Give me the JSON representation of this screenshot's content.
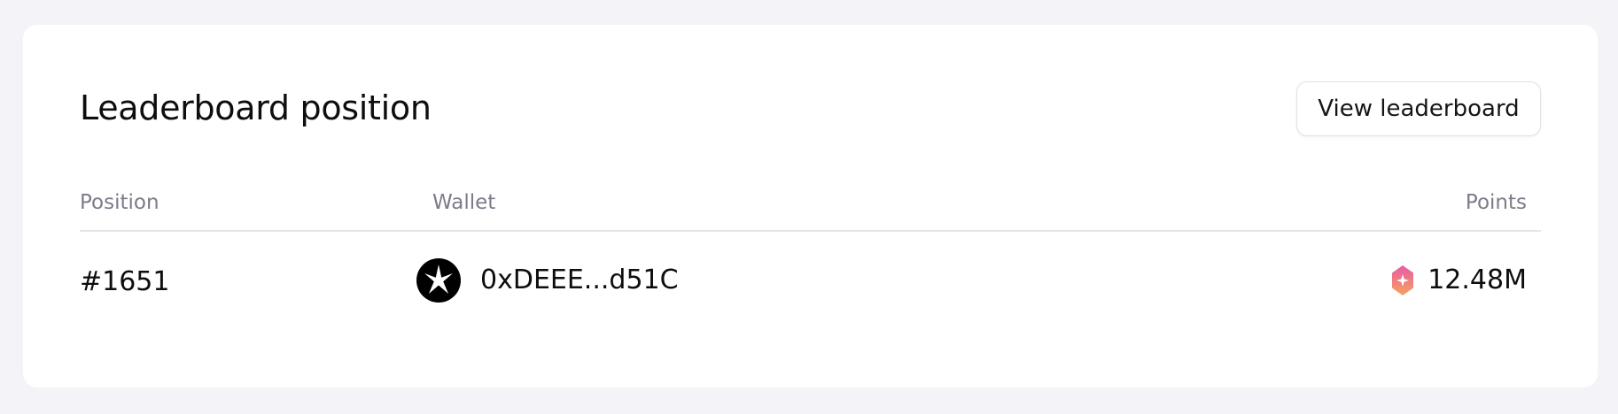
{
  "card": {
    "title": "Leaderboard position",
    "view_button_label": "View leaderboard"
  },
  "table": {
    "columns": {
      "position": "Position",
      "wallet": "Wallet",
      "points": "Points"
    },
    "rows": [
      {
        "position": "#1651",
        "wallet_icon": "compass-star-icon",
        "wallet_address": "0xDEEE...d51C",
        "points_icon": "points-gem-icon",
        "points": "12.48M"
      }
    ]
  },
  "colors": {
    "page_background": "#f4f3f8",
    "card_background": "#ffffff",
    "header_text": "#7d7b8a",
    "body_text": "#0e0e11",
    "gem_gradient_top": "#e85aa8",
    "gem_gradient_bottom": "#f5a35c"
  }
}
